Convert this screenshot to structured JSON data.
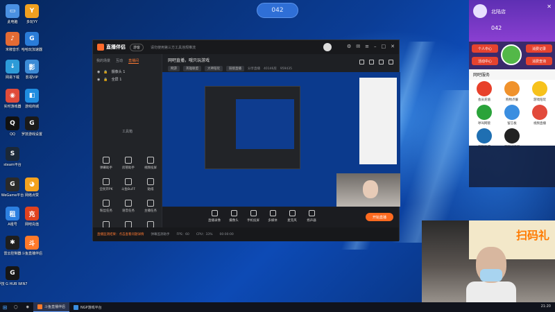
{
  "top_pill": "042",
  "desktop_icons": [
    {
      "label": "此电脑",
      "color": "#4a90e2",
      "glyph": "▭"
    },
    {
      "label": "多玩YY",
      "color": "#f0a020",
      "glyph": "Y"
    },
    {
      "label": "米椒音乐",
      "color": "#e36b34",
      "glyph": "♪"
    },
    {
      "label": "哈哈玩加速器",
      "color": "#2a7cd8",
      "glyph": "G"
    },
    {
      "label": "网易下载",
      "color": "#2d9bd8",
      "glyph": "↓"
    },
    {
      "label": "影视VIP",
      "color": "#3c8bd6",
      "glyph": "影"
    },
    {
      "label": "实时游戏器",
      "color": "#e04b3a",
      "glyph": "◉"
    },
    {
      "label": "游戏商城",
      "color": "#1f8de0",
      "glyph": "◧"
    },
    {
      "label": "QQ",
      "color": "#111111",
      "glyph": "Q"
    },
    {
      "label": "罗技游戏设置",
      "color": "#1a1a1a",
      "glyph": "G"
    },
    {
      "label": "steam平台",
      "color": "#1b2838",
      "glyph": "S"
    },
    {
      "label": "",
      "color": "#000000",
      "glyph": ""
    },
    {
      "label": "WeGame平台",
      "color": "#2a2a2a",
      "glyph": "G"
    },
    {
      "label": "网络点赞",
      "color": "#f4a21f",
      "glyph": "◕"
    },
    {
      "label": "A租号",
      "color": "#2c7fe0",
      "glyph": "租"
    },
    {
      "label": "网吧充值",
      "color": "#e0421f",
      "glyph": "充"
    },
    {
      "label": "雷云控制器",
      "color": "#1e1e1e",
      "glyph": "✱"
    },
    {
      "label": "斗鱼直播伴侣",
      "color": "#ff7a2a",
      "glyph": "斗"
    },
    {
      "label": "罗技 G HUB WIN7",
      "color": "#161616",
      "glyph": "G"
    }
  ],
  "app": {
    "logo": "直播伴侣",
    "badge": "游客",
    "notice": "请勿使用第三方工具违规推流",
    "side_tabs": [
      "我的场景",
      "互动",
      "直播间"
    ],
    "scenes": [
      "摄像头 1",
      "全屏 1"
    ],
    "tools_title": "工具箱",
    "tools": [
      "弹幕助手",
      "房管助手",
      "视频投屏",
      "全民开PK",
      "斗鱼BuFF",
      "贴纸",
      "粉丝任务",
      "语音任务",
      "主播任务",
      "",
      "",
      ""
    ],
    "header_title": "网吧直播，哦只玩游戏",
    "header_chip": "网游",
    "header_items": [
      "英雄联盟",
      "大神陪玩",
      "链接直播"
    ],
    "header_stats": [
      "分享直播",
      "40146房",
      "959435"
    ],
    "controls": [
      "直播录像",
      "摄像头",
      "手机投屏",
      "多媒体",
      "麦克风",
      "扬声器"
    ],
    "start_button": "开始直播",
    "status_hint": "直播监测结果：点击查看问题详情",
    "status_items": [
      "弹幕监测助手",
      "FPS：60",
      "CPU：33%",
      "00:00:00"
    ]
  },
  "rpanel": {
    "shop_name": "北陆店",
    "seat_number": "042",
    "buttons": [
      "个人中心",
      "活动中心",
      "消费记录",
      "消费查询"
    ],
    "section_title": "网吧服务",
    "services": [
      {
        "label": "会员充值",
        "color": "#e8402a"
      },
      {
        "label": "购物点餐",
        "color": "#f0922c"
      },
      {
        "label": "游戏陪玩",
        "color": "#f7c21c"
      },
      {
        "label": "呼叫网管",
        "color": "#2aa33a"
      },
      {
        "label": "留言板",
        "color": "#3a8ee0"
      },
      {
        "label": "视频直播",
        "color": "#e24a3b"
      },
      {
        "label": "英雄联盟",
        "color": "#1f6fb2"
      },
      {
        "label": "海豚加速器",
        "color": "#222222"
      }
    ]
  },
  "webcam": {
    "banner_text": "扫码礼"
  },
  "taskbar": {
    "items": [
      "斗鱼直播伴侣",
      "NGP游戏平台"
    ],
    "time": "21:20"
  }
}
